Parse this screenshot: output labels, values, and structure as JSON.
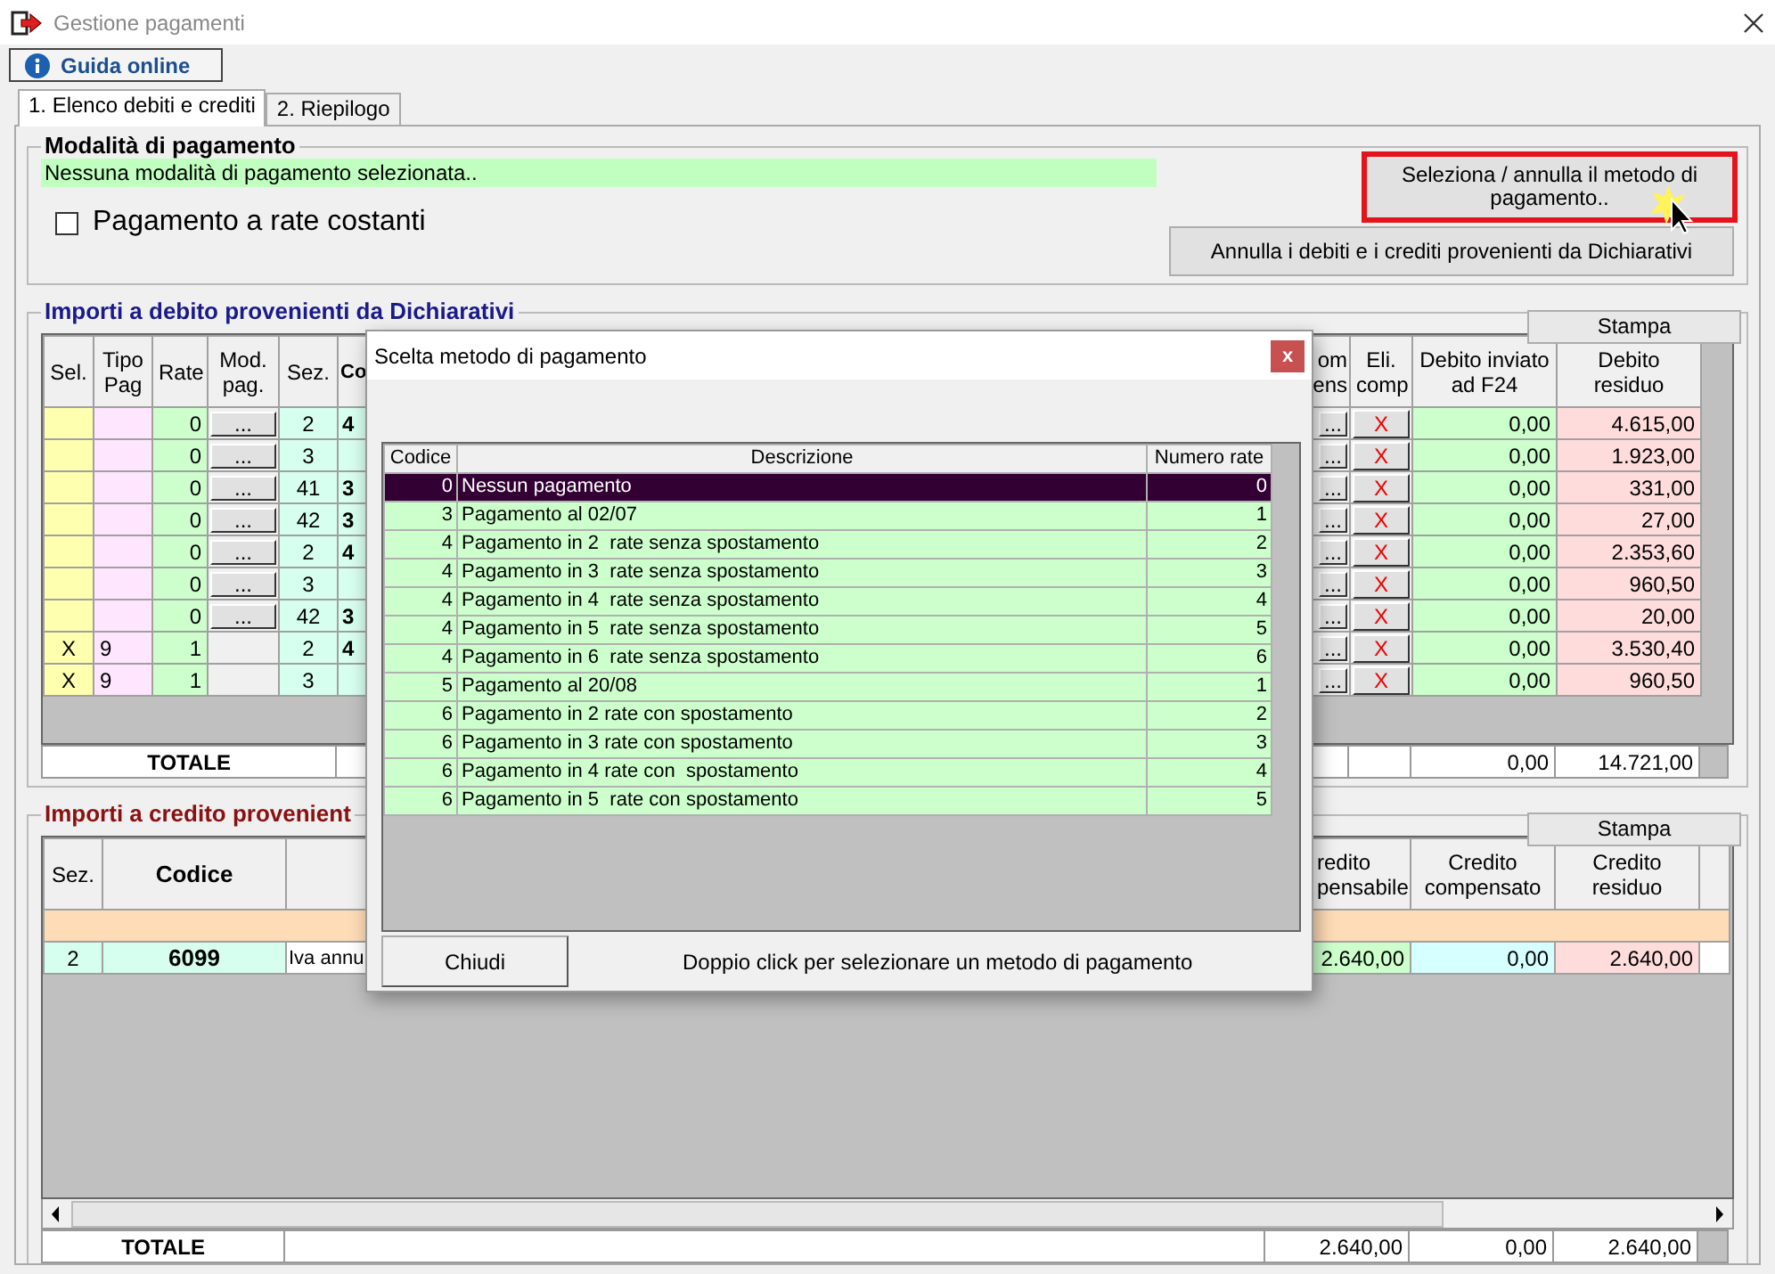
{
  "window": {
    "title": "Gestione pagamenti"
  },
  "help_button": {
    "label": "Guida online"
  },
  "tabs": [
    {
      "label": "1. Elenco debiti e crediti",
      "selected": true
    },
    {
      "label": "2. Riepilogo",
      "selected": false
    }
  ],
  "payment_mode": {
    "title": "Modalità di pagamento",
    "status": "Nessuna modalità di pagamento selezionata..",
    "select_button": {
      "label": "Seleziona / annulla il metodo di pagamento..",
      "highlighted": true
    },
    "constant_installments": {
      "label": "Pagamento a rate costanti",
      "checked": false
    },
    "cancel_button": "Annulla i debiti e i crediti provenienti da Dichiarativi"
  },
  "debits": {
    "title": "Importi a debito provenienti da Dichiarativi",
    "print_button": "Stampa",
    "columns": [
      "Sel.",
      "Tipo\nPag",
      "Rate",
      "Mod.\npag.",
      "Sez.",
      "Co",
      "om\nens",
      "Eli.\ncomp",
      "Debito inviato\nad F24",
      "Debito\nresiduo"
    ],
    "rows": [
      {
        "rate": "0",
        "mod": "...",
        "sez": "2",
        "code": "4",
        "comp": "...",
        "eli": "X",
        "sent": "0,00",
        "residual": "4.615,00"
      },
      {
        "rate": "0",
        "mod": "...",
        "sez": "3",
        "comp": "...",
        "eli": "X",
        "sent": "0,00",
        "residual": "1.923,00"
      },
      {
        "rate": "0",
        "mod": "...",
        "sez": "41",
        "code": "3",
        "comp": "...",
        "eli": "X",
        "sent": "0,00",
        "residual": "331,00"
      },
      {
        "rate": "0",
        "mod": "...",
        "sez": "42",
        "code": "3",
        "comp": "...",
        "eli": "X",
        "sent": "0,00",
        "residual": "27,00"
      },
      {
        "rate": "0",
        "mod": "...",
        "sez": "2",
        "code": "4",
        "comp": "...",
        "eli": "X",
        "sent": "0,00",
        "residual": "2.353,60"
      },
      {
        "rate": "0",
        "mod": "...",
        "sez": "3",
        "comp": "...",
        "eli": "X",
        "sent": "0,00",
        "residual": "960,50"
      },
      {
        "rate": "0",
        "mod": "...",
        "sez": "42",
        "code": "3",
        "comp": "...",
        "eli": "X",
        "sent": "0,00",
        "residual": "20,00"
      },
      {
        "sel": "X",
        "type": "9",
        "rate": "1",
        "sez": "2",
        "code": "4",
        "comp": "...",
        "eli": "X",
        "sent": "0,00",
        "residual": "3.530,40"
      },
      {
        "sel": "X",
        "type": "9",
        "rate": "1",
        "sez": "3",
        "comp": "...",
        "eli": "X",
        "sent": "0,00",
        "residual": "960,50"
      }
    ],
    "total": {
      "label": "TOTALE",
      "sent": "0,00",
      "residual": "14.721,00"
    }
  },
  "credits": {
    "title": "Importi a credito provenient",
    "print_button": "Stampa",
    "columns": [
      "Sez.",
      "Codice",
      "redito\npensabile",
      "Credito\ncompensato",
      "Credito\nresiduo"
    ],
    "rows": [
      {
        "kind": "group"
      },
      {
        "kind": "item",
        "sez": "2",
        "code": "6099",
        "description": "Iva annu",
        "usable": "2.640,00",
        "used": "0,00",
        "residual": "2.640,00"
      }
    ],
    "total": {
      "label": "TOTALE",
      "usable": "2.640,00",
      "used": "0,00",
      "residual": "2.640,00"
    }
  },
  "dialog": {
    "title": "Scelta metodo di pagamento",
    "close": "x",
    "columns": [
      "Codice",
      "Descrizione",
      "Numero rate"
    ],
    "rows": [
      {
        "code": "0",
        "description": "Nessun pagamento",
        "installments": "0",
        "selected": true
      },
      {
        "code": "3",
        "description": "Pagamento al 02/07",
        "installments": "1",
        "selected": false
      },
      {
        "code": "4",
        "description": "Pagamento in 2  rate senza spostamento",
        "installments": "2",
        "selected": false
      },
      {
        "code": "4",
        "description": "Pagamento in 3  rate senza spostamento",
        "installments": "3",
        "selected": false
      },
      {
        "code": "4",
        "description": "Pagamento in 4  rate senza spostamento",
        "installments": "4",
        "selected": false
      },
      {
        "code": "4",
        "description": "Pagamento in 5  rate senza spostamento",
        "installments": "5",
        "selected": false
      },
      {
        "code": "4",
        "description": "Pagamento in 6  rate senza spostamento",
        "installments": "6",
        "selected": false
      },
      {
        "code": "5",
        "description": "Pagamento al 20/08",
        "installments": "1",
        "selected": false
      },
      {
        "code": "6",
        "description": "Pagamento in 2 rate con spostamento",
        "installments": "2",
        "selected": false
      },
      {
        "code": "6",
        "description": "Pagamento in 3 rate con spostamento",
        "installments": "3",
        "selected": false
      },
      {
        "code": "6",
        "description": "Pagamento in 4 rate con  spostamento",
        "installments": "4",
        "selected": false
      },
      {
        "code": "6",
        "description": "Pagamento in 5  rate con spostamento",
        "installments": "5",
        "selected": false
      }
    ],
    "close_button": "Chiudi",
    "hint": "Doppio click per selezionare un metodo di pagamento"
  }
}
